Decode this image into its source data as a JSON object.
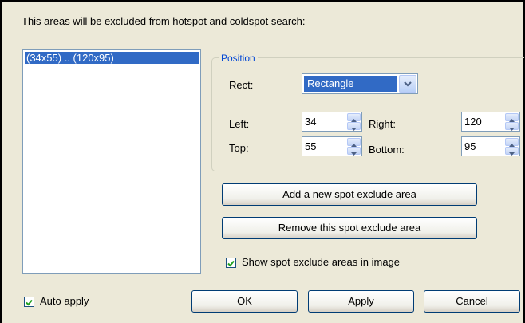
{
  "dialog": {
    "heading": "This areas will be excluded from hotspot and coldspot search:"
  },
  "list": {
    "items": [
      "(34x55) .. (120x95)"
    ]
  },
  "position": {
    "group_title": "Position",
    "rect_label": "Rect:",
    "rect_value": "Rectangle",
    "left_label": "Left:",
    "left_value": "34",
    "right_label": "Right:",
    "right_value": "120",
    "top_label": "Top:",
    "top_value": "55",
    "bottom_label": "Bottom:",
    "bottom_value": "95"
  },
  "actions": {
    "add_label": "Add a new spot exclude area",
    "remove_label": "Remove this spot exclude area",
    "show_label": "Show spot exclude areas in image",
    "show_checked": true
  },
  "footer": {
    "auto_apply_label": "Auto apply",
    "auto_apply_checked": true,
    "ok_label": "OK",
    "apply_label": "Apply",
    "cancel_label": "Cancel"
  },
  "icons": {
    "dropdown": "chevron-down-icon",
    "spin_up": "arrow-up-icon",
    "spin_down": "arrow-down-icon",
    "check": "checkmark-icon"
  },
  "colors": {
    "selection": "#316ac5",
    "group_title": "#0046d5",
    "background": "#ece9d8"
  }
}
